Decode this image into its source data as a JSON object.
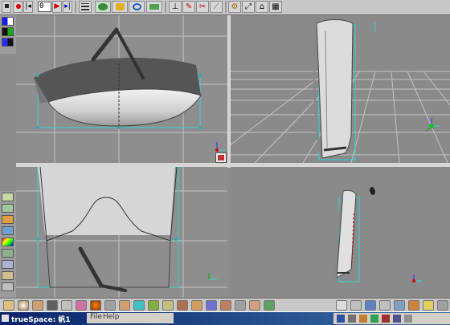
{
  "toolbar": {
    "frame_value": "0",
    "buttons": [
      "record-icon",
      "rewind-icon",
      "prev-frame-icon",
      "play-icon",
      "end-icon",
      "film-icon",
      "object-move-icon",
      "select-icon",
      "rotate-icon",
      "scale-icon",
      "link-icon",
      "undo-icon",
      "redo-icon",
      "scissors-icon",
      "axes-icon",
      "paint-icon",
      "glue-icon",
      "home-icon",
      "arrow-up-icon",
      "lock-icon"
    ]
  },
  "taskbar": {
    "app_title": "trueSpace: 帆1",
    "menu_file": "File",
    "menu_help": "Help"
  },
  "colors": {
    "viewport_bg": "#8e8e8e",
    "grid": "#cfcfcf",
    "axis_cyan": "#35d4d4",
    "axis_blue": "#2a2aff",
    "taskbar_blue": "#0a246a"
  }
}
